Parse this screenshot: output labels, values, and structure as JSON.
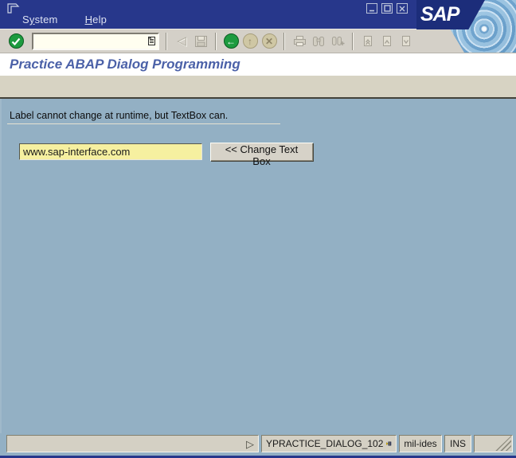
{
  "titlebar": {
    "logo": "SAP",
    "menu": {
      "items": [
        {
          "pre": "S",
          "u": "y",
          "post": "stem"
        },
        {
          "pre": "",
          "u": "H",
          "post": "elp"
        }
      ]
    }
  },
  "toolbar": {
    "command_field": {
      "value": ""
    }
  },
  "screen": {
    "title": "Practice ABAP Dialog Programming"
  },
  "content": {
    "label": "Label cannot change at runtime, but TextBox can.",
    "textbox": {
      "value": "www.sap-interface.com"
    },
    "change_button": "<< Change Text Box"
  },
  "statusbar": {
    "message": "",
    "transaction": "YPRACTICE_DIALOG_102",
    "system": "mil-ides",
    "insert_mode": "INS"
  },
  "colors": {
    "titlebar_navy": "#27378b",
    "logo_navy": "#1c2d7a",
    "toolbar_gray": "#d4d0c8",
    "appbar_beige": "#d7d3c3",
    "content_blue": "#93b0c4",
    "input_yellow": "#f6f0a0",
    "title_text_blue": "#4b61a8",
    "enter_green": "#1d9b3f"
  }
}
